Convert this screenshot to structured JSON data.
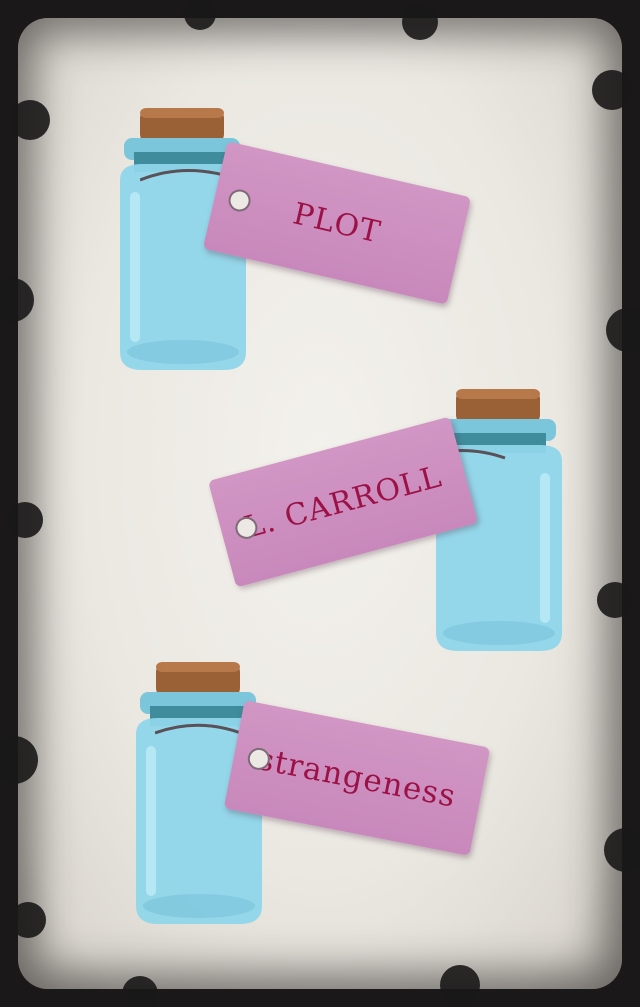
{
  "labels": {
    "tag1": "PLOT",
    "tag2": "L. CARROLL",
    "tag3": "strangeness"
  },
  "colors": {
    "tag_fill": "#c888bb",
    "tag_text": "#9c1246",
    "bottle_glass": "#8fd6ea",
    "cork": "#9a6036",
    "frame": "#1a1818"
  }
}
